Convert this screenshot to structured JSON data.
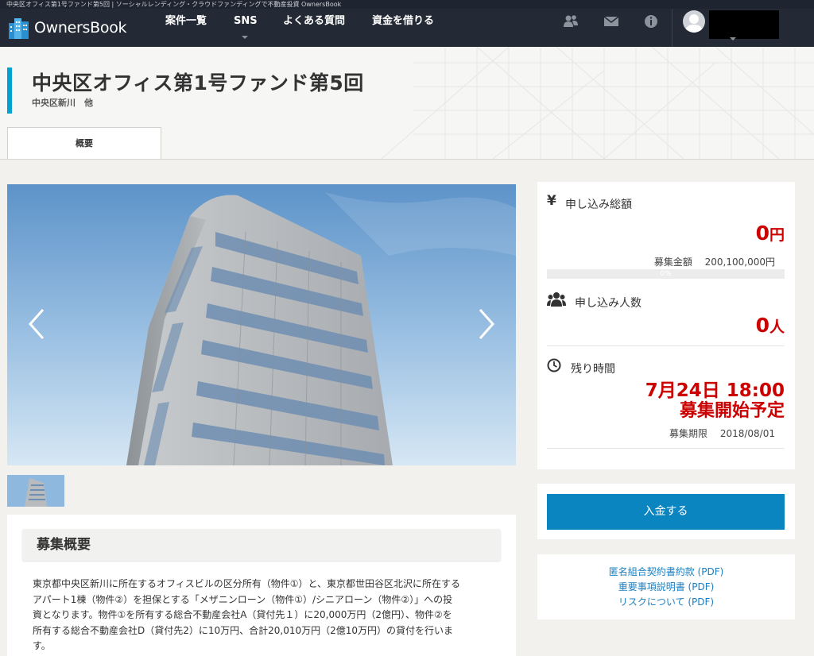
{
  "browser": {
    "title": "中央区オフィス第1号ファンド第5回 | ソーシャルレンディング・クラウドファンディングで不動産投資 OwnersBook"
  },
  "nav": {
    "logo_text": "OwnersBook",
    "items": [
      {
        "label": "案件一覧"
      },
      {
        "label": "SNS"
      },
      {
        "label": "よくある質問"
      },
      {
        "label": "資金を借りる"
      }
    ],
    "icons": [
      "users-icon",
      "mail-icon",
      "info-icon"
    ]
  },
  "hero": {
    "title": "中央区オフィス第1号ファンド第5回",
    "subtitle": "中央区新川　他",
    "tab_label": "概要"
  },
  "stats": {
    "total_label": "申し込み総額",
    "total_value": "0",
    "total_unit": "円",
    "target_label": "募集金額",
    "target_value": "200,100,000円",
    "progress": 0,
    "progress_text": "0%",
    "investors_label": "申し込み人数",
    "investors_value": "0",
    "investors_unit": "人",
    "remaining_label": "残り時間",
    "start_datetime": "7月24日 18:00",
    "start_status": "募集開始予定",
    "deadline_label": "募集期限",
    "deadline_value": "2018/08/01"
  },
  "actions": {
    "deposit_label": "入金する"
  },
  "links": [
    {
      "label": "匿名組合契約書約款 (PDF)"
    },
    {
      "label": "重要事項説明書 (PDF)"
    },
    {
      "label": "リスクについて (PDF)"
    }
  ],
  "overview": {
    "heading": "募集概要",
    "lines": [
      "東京都中央区新川に所在するオフィスビルの区分所有（物件①）と、東京都世田谷区北沢に所在する",
      "アパート1棟（物件②）を担保とする「メザニンローン（物件①）/シニアローン（物件②）」への投",
      "資となります。物件①を所有する総合不動産会社A（貸付先１）に20,000万円（2億円）、物件②を",
      "所有する総合不動産会社D（貸付先2）に10万円、合計20,010万円（2億10万円）の貸付を行いま",
      "す。"
    ]
  },
  "colors": {
    "accent": "#00a0d2",
    "navbar": "#232a35",
    "highlight": "#cc0000",
    "button": "#0b85c0",
    "link": "#1a7fc1"
  }
}
